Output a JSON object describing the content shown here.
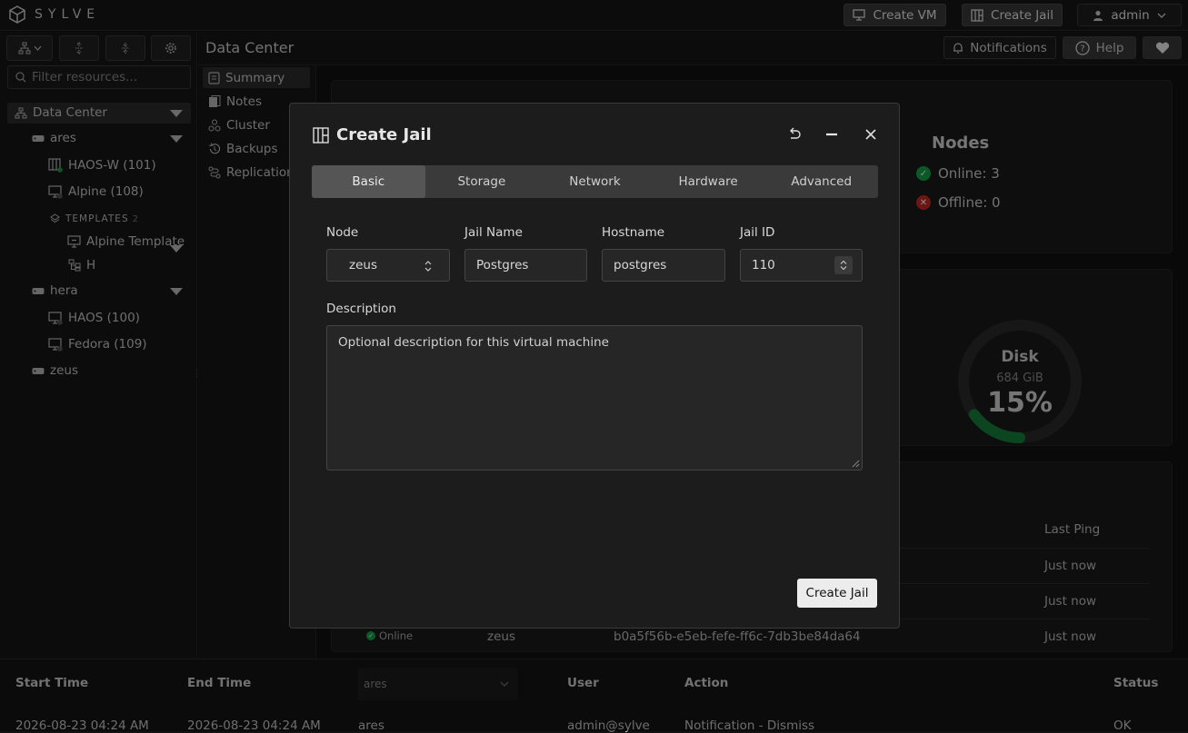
{
  "app": {
    "logo_text": "SYLVE"
  },
  "topbar": {
    "create_vm": "Create VM",
    "create_jail": "Create Jail",
    "user": "admin"
  },
  "sidebar": {
    "filter_placeholder": "Filter resources...",
    "tree": {
      "datacenter": "Data Center",
      "ares": "ares",
      "ares_items": [
        "HAOS-W (101)",
        "Alpine (108)"
      ],
      "templates_label": "TEMPLATES",
      "templates_count": "2",
      "templates": [
        "Alpine Template",
        "H"
      ],
      "hera": "hera",
      "hera_items": [
        "HAOS (100)",
        "Fedora (109)"
      ],
      "zeus": "zeus"
    }
  },
  "header": {
    "title": "Data Center",
    "notifications": "Notifications",
    "help": "Help"
  },
  "subnav": [
    "Summary",
    "Notes",
    "Cluster",
    "Backups",
    "Replication"
  ],
  "dashboard": {
    "nodes_title": "Nodes",
    "online": "Online: 3",
    "offline": "Offline: 0",
    "disk": {
      "label": "Disk",
      "size": "684 GiB",
      "percent_text": "15%",
      "percent": 15
    },
    "table": {
      "last_ping_header": "Last Ping",
      "pings": [
        "Just now",
        "Just now",
        "Just now"
      ],
      "visible_row": {
        "status": "Online",
        "node": "zeus",
        "id": "b0a5f56b-e5eb-fefe-ff6c-7db3be84da64"
      }
    }
  },
  "audit": {
    "headers": [
      "Start Time",
      "End Time",
      "User",
      "Action",
      "Status"
    ],
    "filter_value": "ares",
    "row": [
      "2026-08-23 04:24 AM",
      "2026-08-23 04:24 AM",
      "ares",
      "admin@sylve",
      "Notification - Dismiss",
      "OK"
    ]
  },
  "modal": {
    "title": "Create Jail",
    "tabs": [
      "Basic",
      "Storage",
      "Network",
      "Hardware",
      "Advanced"
    ],
    "active_tab": "Basic",
    "node_label": "Node",
    "node_value": "zeus",
    "jail_name_label": "Jail Name",
    "jail_name_value": "Postgres",
    "hostname_label": "Hostname",
    "hostname_value": "postgres",
    "jail_id_label": "Jail ID",
    "jail_id_value": "110",
    "description_label": "Description",
    "description_placeholder": "Optional description for this virtual machine",
    "submit": "Create Jail"
  },
  "colors": {
    "accent_green": "#16a34a",
    "error_red": "#c62828"
  }
}
